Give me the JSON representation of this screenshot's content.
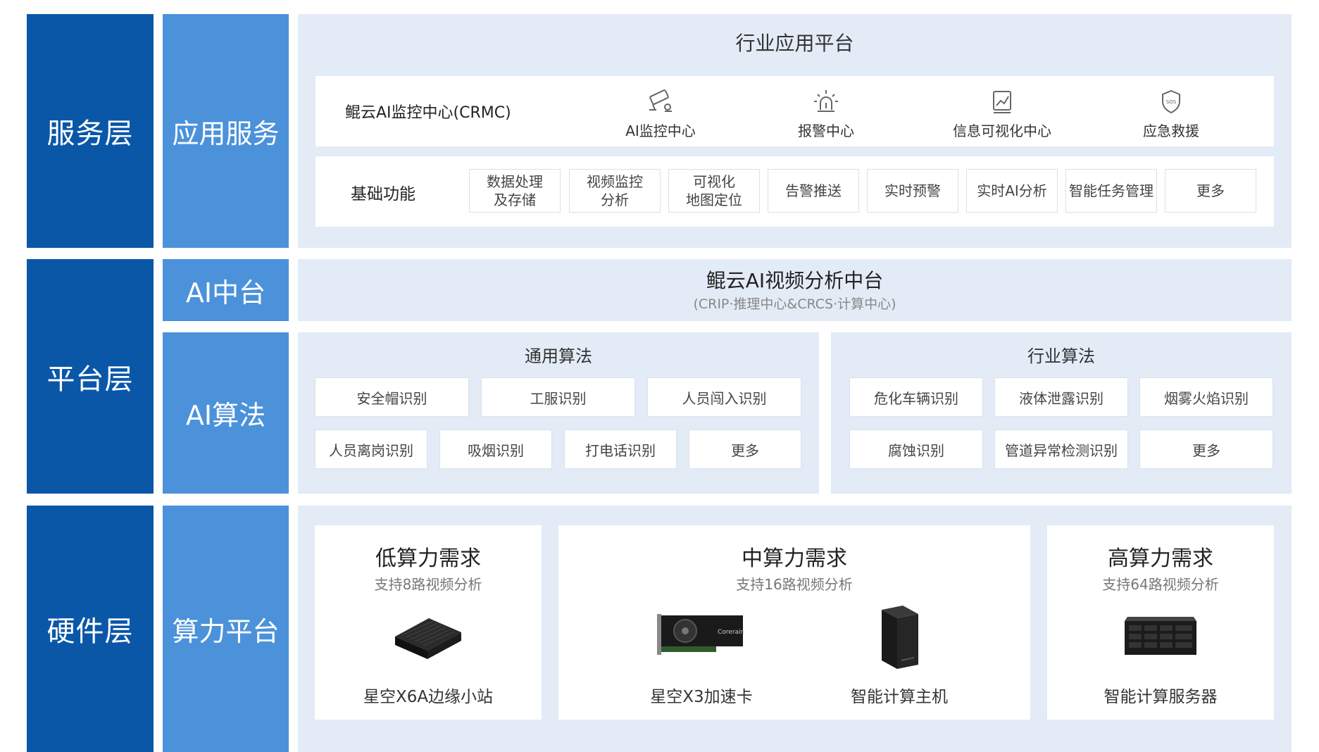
{
  "layers": {
    "service": "服务层",
    "platform": "平台层",
    "hardware": "硬件层"
  },
  "sublayers": {
    "app_service": "应用服务",
    "ai_center": "AI中台",
    "ai_algorithm": "AI算法",
    "compute_platform": "算力平台"
  },
  "service": {
    "panel_title": "行业应用平台",
    "crmc_label": "鲲云AI监控中心(CRMC)",
    "apps": [
      {
        "label": "AI监控中心",
        "icon": "camera-icon"
      },
      {
        "label": "报警中心",
        "icon": "alarm-light-icon"
      },
      {
        "label": "信息可视化中心",
        "icon": "chart-icon"
      },
      {
        "label": "应急救援",
        "icon": "sos-shield-icon"
      }
    ],
    "basic_label": "基础功能",
    "basic_functions": [
      [
        "数据处理",
        "及存储"
      ],
      [
        "视频监控",
        "分析"
      ],
      [
        "可视化",
        "地图定位"
      ],
      [
        "告警推送"
      ],
      [
        "实时预警"
      ],
      [
        "实时AI分析"
      ],
      [
        "智能任务管理"
      ],
      [
        "更多"
      ]
    ]
  },
  "ai_center": {
    "title": "鲲云AI视频分析中台",
    "subtitle": "(CRIP·推理中心&CRCS·计算中心)"
  },
  "algorithms": {
    "general_title": "通用算法",
    "general_row1": [
      "安全帽识别",
      "工服识别",
      "人员闯入识别"
    ],
    "general_row2": [
      "人员离岗识别",
      "吸烟识别",
      "打电话识别",
      "更多"
    ],
    "industry_title": "行业算法",
    "industry_row1": [
      "危化车辆识别",
      "液体泄露识别",
      "烟雾火焰识别"
    ],
    "industry_row2": [
      "腐蚀识别",
      "管道异常检测识别",
      "更多"
    ]
  },
  "hardware": {
    "low": {
      "title": "低算力需求",
      "subtitle": "支持8路视频分析",
      "products": [
        "星空X6A边缘小站"
      ]
    },
    "mid": {
      "title": "中算力需求",
      "subtitle": "支持16路视频分析",
      "products": [
        "星空X3加速卡",
        "智能计算主机"
      ]
    },
    "high": {
      "title": "高算力需求",
      "subtitle": "支持64路视频分析",
      "products": [
        "智能计算服务器"
      ]
    }
  },
  "colors": {
    "layer_blue": "#0a57a8",
    "sublayer_blue": "#4b92da",
    "panel_bg": "#e3ebf6"
  }
}
